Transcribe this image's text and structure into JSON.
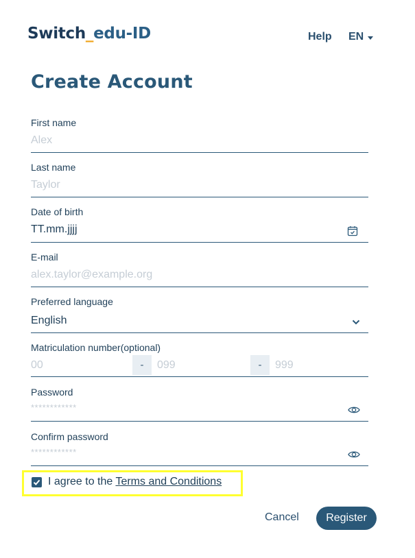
{
  "header": {
    "logo_part1": "Switch",
    "logo_underscore": "_",
    "logo_part2": "edu-ID",
    "help_label": "Help",
    "language_label": "EN"
  },
  "page_title": "Create Account",
  "fields": {
    "first_name": {
      "label": "First name",
      "placeholder": "Alex"
    },
    "last_name": {
      "label": "Last name",
      "placeholder": "Taylor"
    },
    "date_of_birth": {
      "label": "Date of birth",
      "value": "TT.mm.jjjj"
    },
    "email": {
      "label": "E-mail",
      "placeholder": "alex.taylor@example.org"
    },
    "preferred_language": {
      "label": "Preferred language",
      "value": "English"
    },
    "matriculation": {
      "label": "Matriculation number(optional)",
      "part1_placeholder": "00",
      "part2_placeholder": "099",
      "part3_placeholder": "999",
      "separator": "-"
    },
    "password": {
      "label": "Password",
      "placeholder": "************"
    },
    "confirm_password": {
      "label": "Confirm password",
      "placeholder": "************"
    }
  },
  "agreement": {
    "text": "I agree to the ",
    "link": "Terms and Conditions",
    "checked": true
  },
  "actions": {
    "cancel_label": "Cancel",
    "register_label": "Register"
  },
  "colors": {
    "primary": "#2a5878",
    "logo_accent": "#f0a41a",
    "highlight": "#ffff30"
  }
}
